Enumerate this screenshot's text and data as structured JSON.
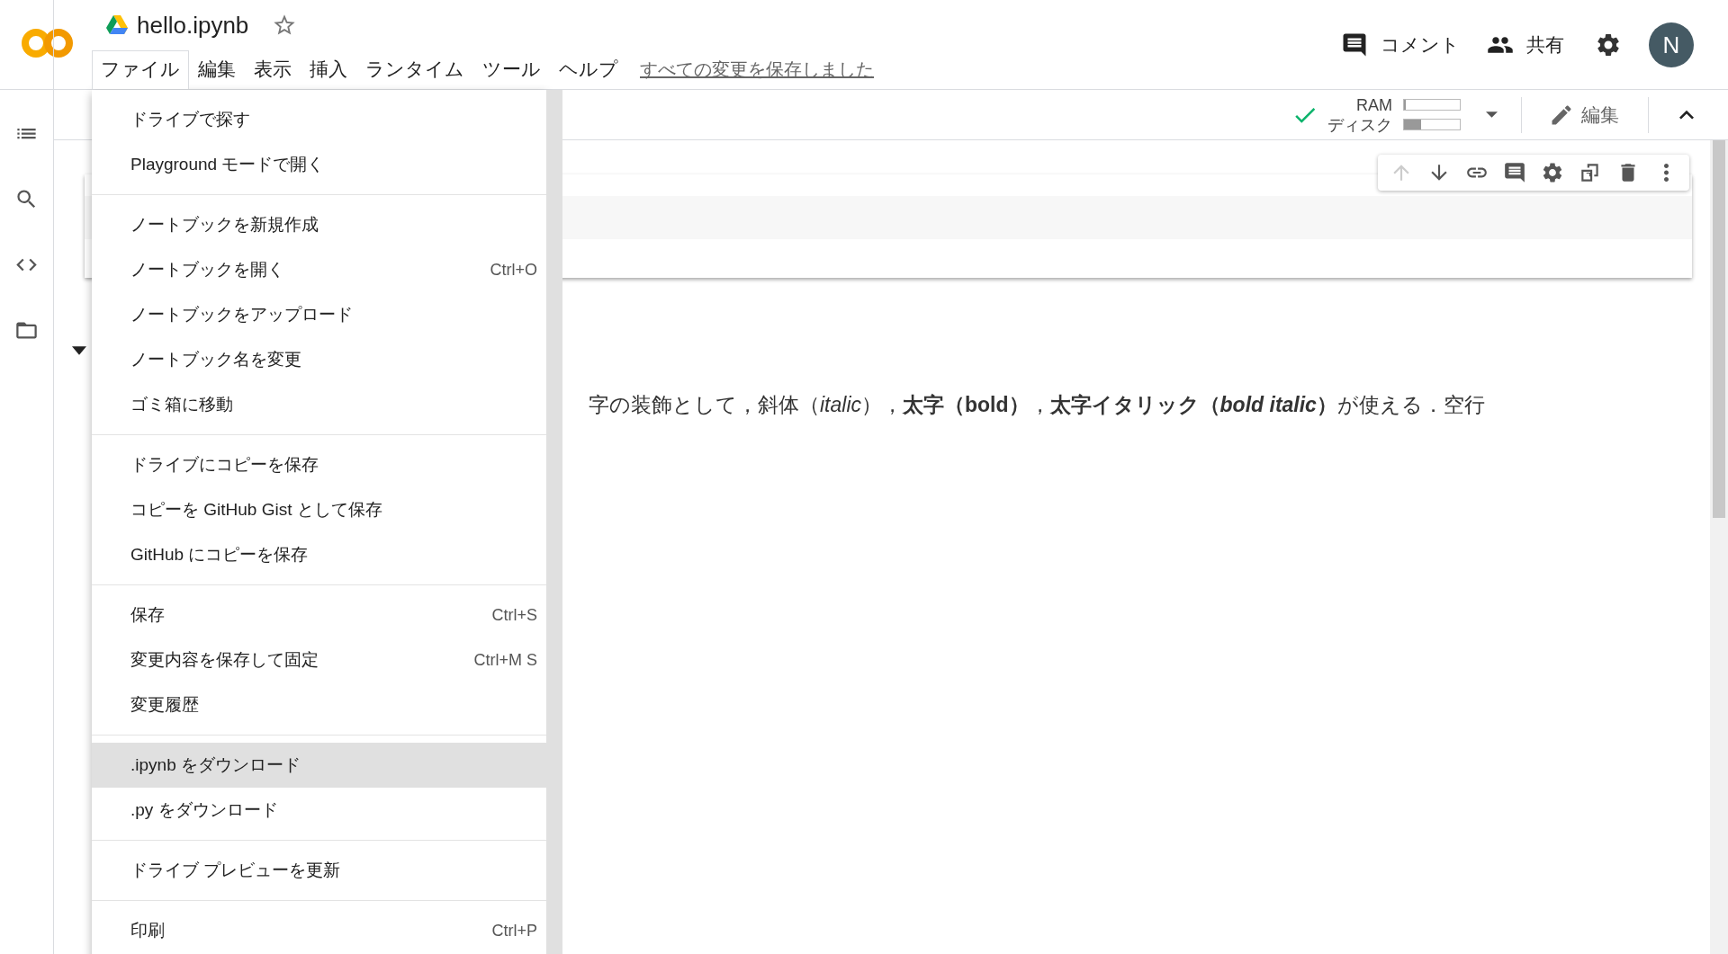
{
  "notebook": {
    "title": "hello.ipynb",
    "starred": false
  },
  "menu_bar": {
    "items": [
      {
        "label": "ファイル",
        "selected": true
      },
      {
        "label": "編集",
        "selected": false
      },
      {
        "label": "表示",
        "selected": false
      },
      {
        "label": "挿入",
        "selected": false
      },
      {
        "label": "ランタイム",
        "selected": false
      },
      {
        "label": "ツール",
        "selected": false
      },
      {
        "label": "ヘルプ",
        "selected": false
      }
    ],
    "save_status": "すべての変更を保存しました"
  },
  "header_actions": [
    {
      "kind": "comment",
      "label": "コメント"
    },
    {
      "kind": "share",
      "label": "共有"
    }
  ],
  "avatar": "N",
  "runtime": {
    "connected": true,
    "ram": {
      "label": "RAM",
      "level": 0.03
    },
    "disk": {
      "label": "ディスク",
      "level": 0.3
    }
  },
  "edit_button": "編集",
  "cell_toolbar": [
    {
      "kind": "up",
      "disabled": true
    },
    {
      "kind": "down",
      "disabled": false
    },
    {
      "kind": "link",
      "disabled": false
    },
    {
      "kind": "comment",
      "disabled": false
    },
    {
      "kind": "settings",
      "disabled": false
    },
    {
      "kind": "mirror",
      "disabled": false
    },
    {
      "kind": "delete",
      "disabled": false
    },
    {
      "kind": "more",
      "disabled": false
    }
  ],
  "file_menu": {
    "sections": [
      [
        {
          "label": "ドライブで探す",
          "highlighted": false
        },
        {
          "label": "Playground モードで開く",
          "highlighted": false
        }
      ],
      [
        {
          "label": "ノートブックを新規作成",
          "highlighted": false
        },
        {
          "label": "ノートブックを開く",
          "shortcut": "Ctrl+O",
          "highlighted": false
        },
        {
          "label": "ノートブックをアップロード",
          "highlighted": false
        },
        {
          "label": "ノートブック名を変更",
          "highlighted": false
        },
        {
          "label": "ゴミ箱に移動",
          "highlighted": false
        }
      ],
      [
        {
          "label": "ドライブにコピーを保存",
          "highlighted": false
        },
        {
          "label": "コピーを GitHub Gist として保存",
          "highlighted": false
        },
        {
          "label": "GitHub にコピーを保存",
          "highlighted": false
        }
      ],
      [
        {
          "label": "保存",
          "shortcut": "Ctrl+S",
          "highlighted": false
        },
        {
          "label": "変更内容を保存して固定",
          "shortcut": "Ctrl+M S",
          "highlighted": false
        },
        {
          "label": "変更履歴",
          "highlighted": false
        }
      ],
      [
        {
          "label": ".ipynb をダウンロード",
          "highlighted": true
        },
        {
          "label": ".py をダウンロード",
          "highlighted": false
        }
      ],
      [
        {
          "label": "ドライブ プレビューを更新",
          "highlighted": false
        }
      ],
      [
        {
          "label": "印刷",
          "shortcut": "Ctrl+P",
          "highlighted": false
        }
      ]
    ]
  },
  "notebook_content": {
    "paragraph": "字の装飾として，斜体（*italic*），**太字（bold）**，**太字イタリック（*bold italic*）**が使える．空行"
  }
}
